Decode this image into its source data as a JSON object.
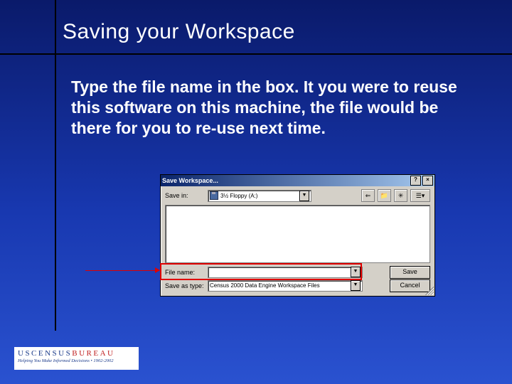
{
  "title": "Saving your Workspace",
  "body": "Type the file name in the box.  It you were to reuse this software on this machine, the file would be there for you to re-use next time.",
  "dialog": {
    "title": "Save Workspace...",
    "help_btn": "?",
    "close_btn": "×",
    "savein_label": "Save in:",
    "savein_value": "3½ Floppy (A:)",
    "filename_label": "File name:",
    "filename_value": "",
    "saveastype_label": "Save as type:",
    "saveastype_value": "Census 2000 Data Engine Workspace Files",
    "save_btn": "Save",
    "cancel_btn": "Cancel",
    "icons": {
      "back": "⇐",
      "up": "📁",
      "new": "✳",
      "view": "☰▾"
    }
  },
  "footer": {
    "line1_pre": "USCENSUS",
    "line1_post": "BUREAU",
    "line2": "Helping You Make Informed Decisions • 1902-2002"
  }
}
